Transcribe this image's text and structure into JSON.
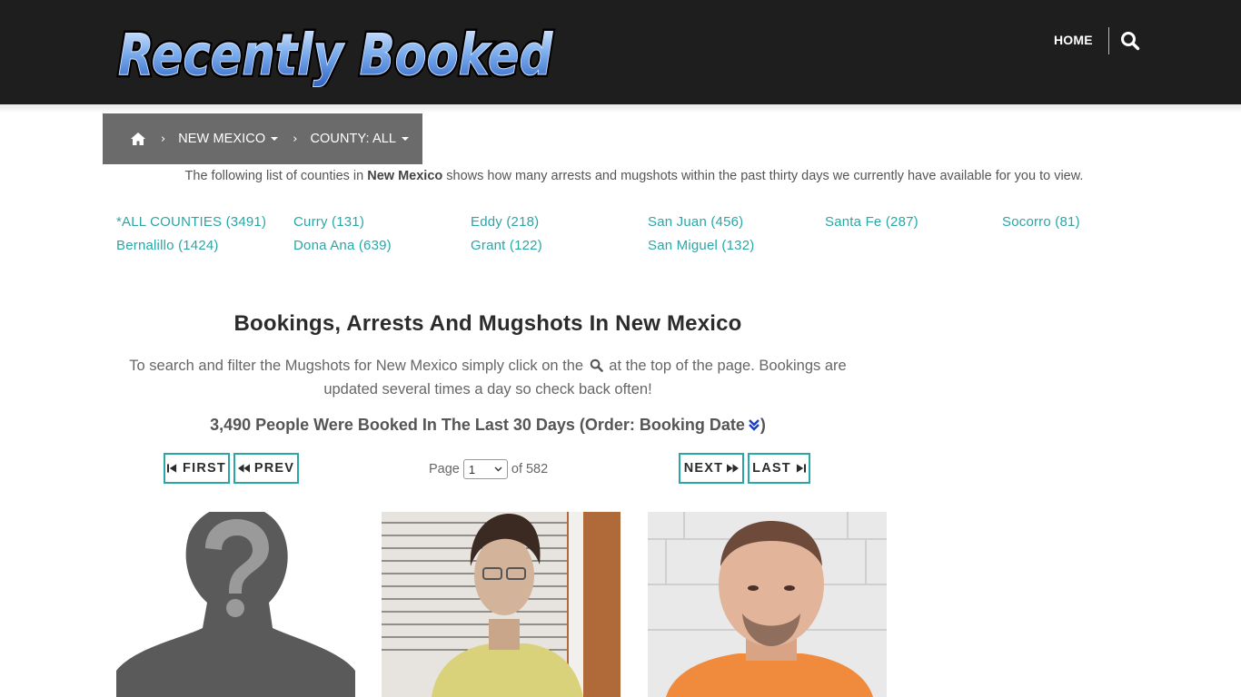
{
  "header": {
    "logo_text": "Recently Booked",
    "home_label": "HOME"
  },
  "breadcrumb": {
    "state_label": "NEW MEXICO",
    "county_label": "COUNTY: ALL"
  },
  "intro": {
    "prefix": "The following list of counties in ",
    "state": "New Mexico",
    "suffix": " shows how many arrests and mugshots within the past thirty days we currently have available for you to view."
  },
  "counties": [
    "*ALL COUNTIES (3491)",
    "Curry (131)",
    "Eddy (218)",
    "San Juan (456)",
    "Santa Fe (287)",
    "Socorro (81)",
    "Bernalillo (1424)",
    "Dona Ana (639)",
    "Grant (122)",
    "San Miguel (132)"
  ],
  "main": {
    "heading": "Bookings, Arrests And Mugshots In New Mexico",
    "help_part1": "To search and filter the Mugshots for New Mexico simply click on the",
    "help_part2": "at the top of the page. Bookings are updated several times a day so check back often!",
    "count_text": "3,490 People Were Booked In The Last 30 Days (Order: Booking Date",
    "count_close": ")"
  },
  "pagination": {
    "first_label": "FIRST",
    "prev_label": "PREV",
    "next_label": "NEXT",
    "last_label": "LAST",
    "page_prefix": "Page",
    "page_value": "1",
    "page_suffix": "of 582"
  },
  "colors": {
    "accent": "#2aa6a6",
    "topbar": "#1e1e1e",
    "breadcrumb_bg": "#6b6b6b"
  },
  "mugshots": [
    {
      "kind": "placeholder-silhouette"
    },
    {
      "kind": "photo"
    },
    {
      "kind": "photo"
    }
  ]
}
